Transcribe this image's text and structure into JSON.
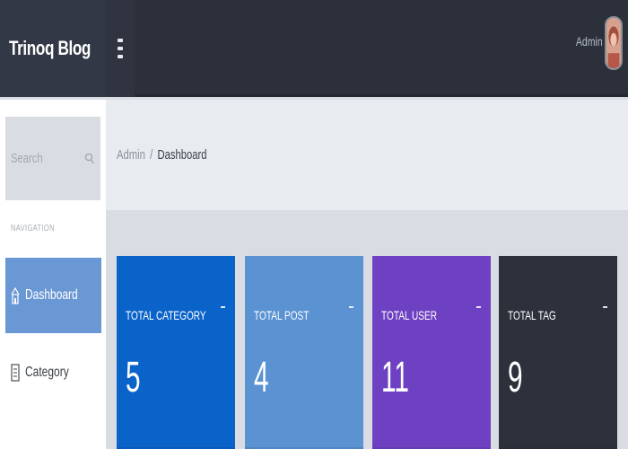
{
  "brand": {
    "name": "Trinoq Blog",
    "icon": "star-icon"
  },
  "topbar": {
    "user_name": "Admin",
    "menu_icon": "hamburger-icon"
  },
  "sidebar": {
    "search_placeholder": "Search",
    "nav_header": "NAVIGATION",
    "items": [
      {
        "label": "Dashboard",
        "icon": "home-icon",
        "active": true
      },
      {
        "label": "Category",
        "icon": "list-icon",
        "active": false
      }
    ]
  },
  "breadcrumb": {
    "root": "Admin",
    "separator": "/",
    "current": "Dashboard"
  },
  "cards": [
    {
      "title": "TOTAL CATEGORY",
      "value": "5",
      "color": "#0a63c9"
    },
    {
      "title": "TOTAL POST",
      "value": "4",
      "color": "#5b92d2"
    },
    {
      "title": "TOTAL USER",
      "value": "11",
      "color": "#6e41c2"
    },
    {
      "title": "TOTAL TAG",
      "value": "9",
      "color": "#2c313b"
    }
  ],
  "colors": {
    "topbar": "#2b303b",
    "accent": "#6a98d4",
    "background": "#d9dde3"
  }
}
